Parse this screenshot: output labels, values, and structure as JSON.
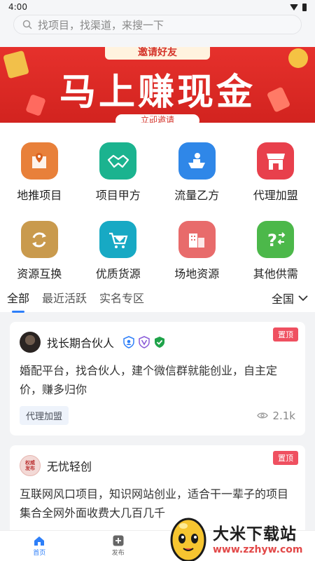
{
  "status": {
    "time": "4:00"
  },
  "search": {
    "placeholder": "找项目，找渠道，来搜一下"
  },
  "banner": {
    "top_text": "邀请好友",
    "main_text": "马上赚现金",
    "bottom_text": "立即邀请"
  },
  "categories": [
    {
      "label": "地推项目",
      "icon": "map-pin-icon",
      "color": "#e8803a"
    },
    {
      "label": "项目甲方",
      "icon": "handshake-icon",
      "color": "#1bb38f"
    },
    {
      "label": "流量乙方",
      "icon": "boat-icon",
      "color": "#2f87e8"
    },
    {
      "label": "代理加盟",
      "icon": "store-icon",
      "color": "#e8404c"
    },
    {
      "label": "资源互换",
      "icon": "exchange-icon",
      "color": "#c99a4d"
    },
    {
      "label": "优质货源",
      "icon": "diamond-cart-icon",
      "color": "#17a9c4"
    },
    {
      "label": "场地资源",
      "icon": "building-icon",
      "color": "#e86b6b"
    },
    {
      "label": "其他供需",
      "icon": "question-icon",
      "color": "#4cb84a"
    }
  ],
  "filters": {
    "tabs": [
      "全部",
      "最近活跃",
      "实名专区"
    ],
    "region": "全国"
  },
  "posts": [
    {
      "pin_label": "置顶",
      "username": "找长期合伙人",
      "text": "婚配平台，找合伙人，建个微信群就能创业，自主定价，赚多归你",
      "tag": "代理加盟",
      "views": "2.1k"
    },
    {
      "pin_label": "置顶",
      "username": "无忧轻创",
      "avatar_text": "权威\n发布",
      "text": "互联网风口项目，知识网站创业，适合干一辈子的项目集合全网外面收费大几百几千"
    }
  ],
  "tabbar": {
    "home": "首页",
    "publish": "发布"
  },
  "watermark": {
    "title": "大米下载站",
    "url": "www.zzhyw.com"
  },
  "colors": {
    "accent": "#2d7ff9",
    "banner": "#e6312c",
    "pin": "#ef5060"
  }
}
